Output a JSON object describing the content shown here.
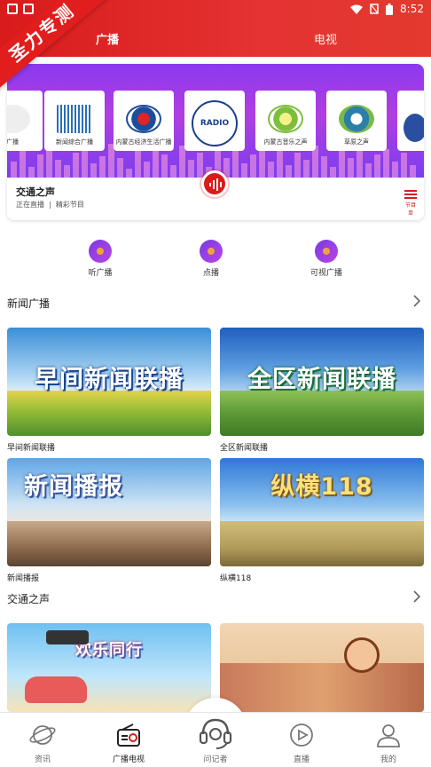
{
  "statusbar": {
    "time": "8:52"
  },
  "ribbon": {
    "text": "圣力专测"
  },
  "tabs": [
    {
      "label": "广播"
    },
    {
      "label": "电视"
    }
  ],
  "banner": {
    "logos": [
      {
        "text": "广播"
      },
      {
        "text": "新闻综合广播"
      },
      {
        "text": "内蒙古经济生活广播"
      },
      {
        "text": "RADIO"
      },
      {
        "text": "内蒙古音乐之声"
      },
      {
        "text": "草原之声"
      }
    ],
    "now_title": "交通之声",
    "now_status": "正在直播",
    "now_program": "精彩节目",
    "list_label": "节目单"
  },
  "quick": [
    {
      "label": "听广播"
    },
    {
      "label": "点播"
    },
    {
      "label": "可视广播"
    }
  ],
  "sections": [
    {
      "title": "新闻广播",
      "cards": [
        {
          "title": "早间新闻联播",
          "caption": "早间新闻联播"
        },
        {
          "title": "全区新闻联播",
          "caption": "全区新闻联播"
        },
        {
          "title": "新闻播报",
          "caption": "新闻播报"
        },
        {
          "title": "纵横118",
          "caption": "纵横118"
        }
      ]
    },
    {
      "title": "交通之声",
      "cards": [
        {
          "title": "欢乐同行",
          "caption": ""
        },
        {
          "title": "",
          "caption": ""
        }
      ]
    }
  ],
  "bottom_nav": [
    {
      "label": "资讯",
      "icon": "planet-icon"
    },
    {
      "label": "广播电视",
      "icon": "radio-icon"
    },
    {
      "label": "问记者",
      "icon": "headset-icon"
    },
    {
      "label": "直播",
      "icon": "play-circle-icon"
    },
    {
      "label": "我的",
      "icon": "user-icon"
    }
  ],
  "colors": {
    "brand": "#d81b1b",
    "banner_purple": "#8b39f0"
  }
}
